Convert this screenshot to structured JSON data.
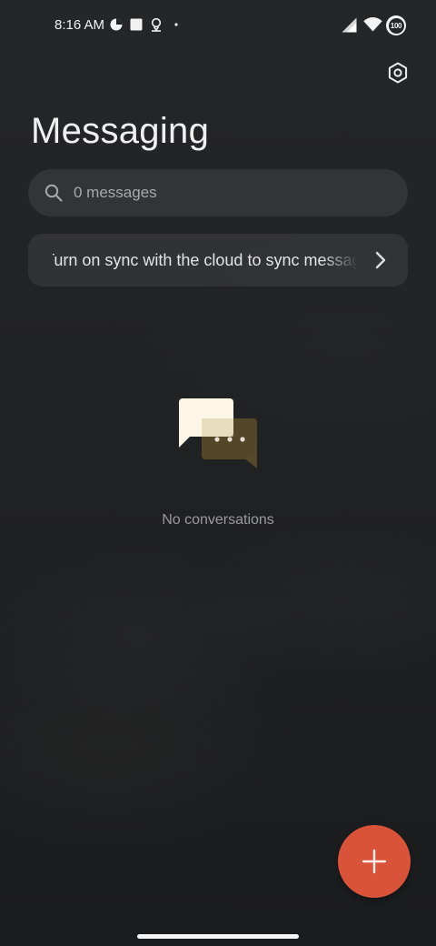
{
  "status_bar": {
    "time": "8:16 AM",
    "battery_level": "100"
  },
  "header": {
    "title": "Messaging",
    "settings_icon": "hexagon-settings-icon"
  },
  "search": {
    "placeholder": "0 messages",
    "icon": "search-icon"
  },
  "sync_banner": {
    "text": "Turn on sync with the cloud to sync messages",
    "icon": "chevron-right-icon"
  },
  "empty_state": {
    "icon": "chat-bubbles-icon",
    "text": "No conversations"
  },
  "fab": {
    "icon": "plus-icon"
  },
  "colors": {
    "accent": "#d9533a",
    "background": "#232426",
    "bubble_front": "#fdf6e6",
    "bubble_back": "#5a4a2a"
  }
}
